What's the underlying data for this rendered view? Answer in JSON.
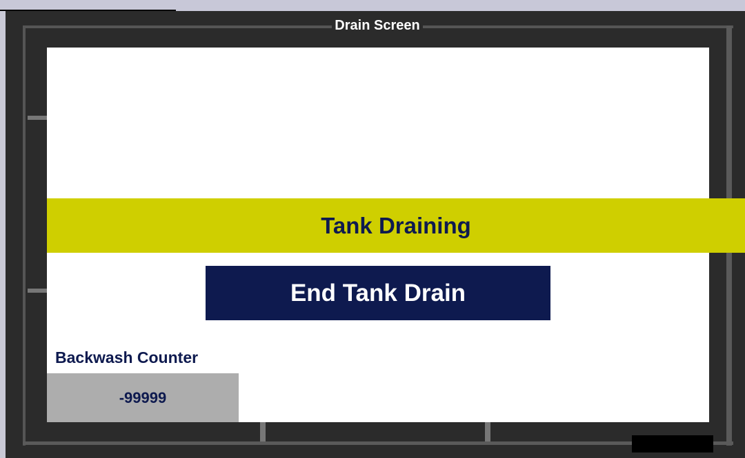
{
  "window": {
    "title": "Drain Screen"
  },
  "status": {
    "text": "Tank Draining",
    "color": "#cfcf00"
  },
  "actions": {
    "end_drain_label": "End Tank Drain",
    "button_color": "#0e1a4f"
  },
  "counter": {
    "label": "Backwash Counter",
    "value": "-99999"
  }
}
